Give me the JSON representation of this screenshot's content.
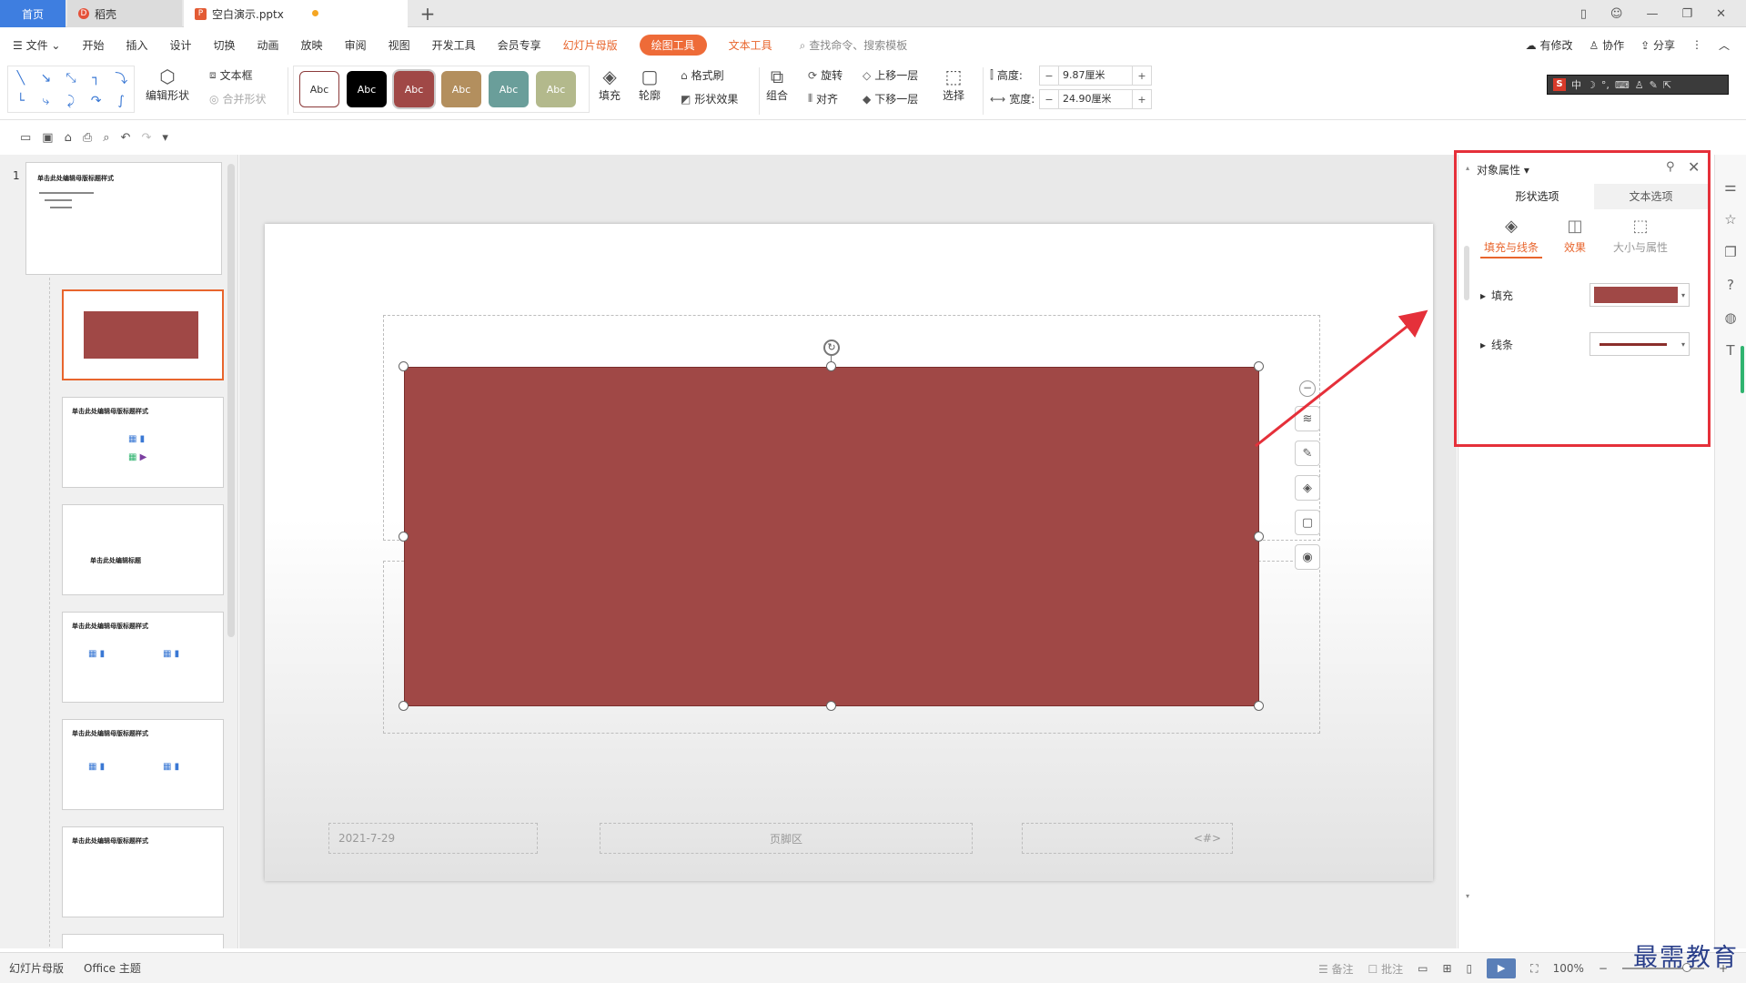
{
  "tabs": {
    "home": "首页",
    "daoke": "稻壳",
    "file": "空白演示.pptx",
    "add": "+"
  },
  "window": {
    "minimize": "—",
    "restore": "❐",
    "close": "✕"
  },
  "menu": {
    "file": "文件",
    "items": [
      "开始",
      "插入",
      "设计",
      "切换",
      "动画",
      "放映",
      "审阅",
      "视图",
      "开发工具",
      "会员专享"
    ],
    "slide_master": "幻灯片母版",
    "drawing_tools": "绘图工具",
    "text_tools": "文本工具",
    "search": "查找命令、搜索模板",
    "modify": "有修改",
    "collab": "协作",
    "share": "分享"
  },
  "ribbon": {
    "edit_shape": "编辑形状",
    "text_box": "文本框",
    "merge_shape": "合并形状",
    "styles": [
      "Abc",
      "Abc",
      "Abc",
      "Abc",
      "Abc",
      "Abc"
    ],
    "style_colors": [
      "#ffffff",
      "#000000",
      "#a04846",
      "#b38f5e",
      "#6a9e9a",
      "#b3b98c"
    ],
    "fill": "填充",
    "outline": "轮廓",
    "format_brush": "格式刷",
    "shape_effects": "形状效果",
    "group": "组合",
    "rotate": "旋转",
    "align": "对齐",
    "bring_forward": "上移一层",
    "send_backward": "下移一层",
    "select": "选择",
    "height_label": "高度:",
    "height_value": "9.87厘米",
    "width_label": "宽度:",
    "width_value": "24.90厘米",
    "ime_label": "中"
  },
  "thumbs": {
    "slide_number": "1",
    "master_title": "单击此处编辑母版标题样式",
    "edit_title": "单击此处编辑标题"
  },
  "slide": {
    "date": "2021-7-29",
    "footer": "页脚区",
    "page_number": "<#>",
    "shape_color": "#a04846"
  },
  "props": {
    "title": "对象属性",
    "tab_shape": "形状选项",
    "tab_text": "文本选项",
    "sub_fill_line": "填充与线条",
    "sub_effects": "效果",
    "sub_size": "大小与属性",
    "fill_label": "填充",
    "line_label": "线条"
  },
  "status": {
    "slide_master": "幻灯片母版",
    "theme": "Office 主题",
    "notes": "备注",
    "comments": "批注",
    "zoom": "100%"
  },
  "watermark": "最需教育"
}
